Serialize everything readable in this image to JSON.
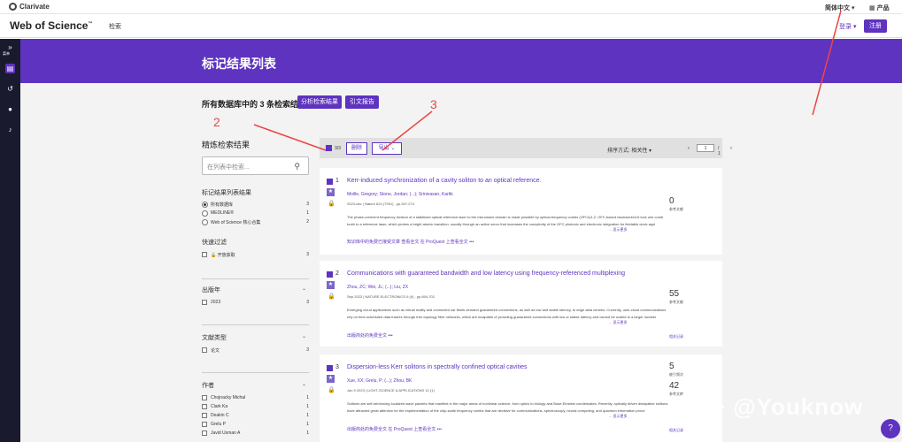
{
  "topbar": {
    "brand": "Clarivate",
    "language": "简体中文",
    "products": "产品"
  },
  "header": {
    "logo": "Web of Science",
    "logo_mark": "™",
    "nav_search": "检索",
    "login": "登录",
    "register": "注册"
  },
  "sidebar": {
    "label": "菜单"
  },
  "banner": {
    "title": "标记结果列表"
  },
  "summary": {
    "text": "所有数据库中的 3 条检索结果",
    "analyze_button": "分析检索结果",
    "citation_button": "引文报告"
  },
  "refine": {
    "title": "精炼检索结果",
    "search_placeholder": "在列表中检索...",
    "marked_lists": {
      "heading": "标记结果列表结果",
      "items": [
        {
          "label": "所有数据库",
          "count": "3"
        },
        {
          "label": "MEDLINE®",
          "count": "1"
        },
        {
          "label": "Web of Science 核心合集",
          "count": "2"
        }
      ]
    },
    "quick_filters": {
      "heading": "快速过滤",
      "items": [
        {
          "label": "开放获取",
          "count": "3"
        }
      ]
    },
    "pub_year": {
      "heading": "出版年",
      "items": [
        {
          "label": "2023",
          "count": "3"
        }
      ]
    },
    "doc_type": {
      "heading": "文献类型",
      "items": [
        {
          "label": "论文",
          "count": "3"
        }
      ]
    },
    "authors": {
      "heading": "作者",
      "items": [
        {
          "label": "Chojnacky Michal",
          "count": "1"
        },
        {
          "label": "Clark Ka",
          "count": "1"
        },
        {
          "label": "Deakin C",
          "count": "1"
        },
        {
          "label": "Grelu P",
          "count": "1"
        },
        {
          "label": "Javid Usman A",
          "count": "1"
        }
      ]
    }
  },
  "toolbar": {
    "selected": "3/3",
    "delete": "删除",
    "export": "导出",
    "sort": "排序方式: 相关性",
    "page_current": "1",
    "page_total": "/ 1"
  },
  "results": [
    {
      "num": "1",
      "title": "Kerr-induced synchronization of a cavity soliton to an optical reference.",
      "authors": "Moille, Gregory; Stone, Jordan; (...); Srinivasan, Kartik",
      "source": "2023-dec | Nature     624 (7991) , pp.267-274",
      "abstract": "The phase-coherent frequency division of a stabilized optical reference laser to the microwave domain is made possible by optical-frequency combs (OFCs)1,2. OFC-based clockworks3-6 lock one comb tooth to a reference laser, which probes a bright atomic transition, usually through an active servo that increases the complexity of the OFC photonic and electronic integration for fieldable clock appl",
      "more": "... 显示更多",
      "links": "知识库中的免费已接受文章    查看全文    在 ProQuest 上查看全文    •••",
      "metric_num": "0",
      "metric_label": "参考文献",
      "related": ""
    },
    {
      "num": "2",
      "title": "Communications with guaranteed bandwidth and low latency using frequency-referenced multiplexing",
      "authors": "Zhou, ZC; Wei, JL; (...); Liu, ZX",
      "source": "Sep 2023 | NATURE ELECTRONICS     6 (9) , pp.694-702",
      "abstract": "Emerging cloud applications such as virtual reality and connected car fleets demand guaranteed connections, as well as low and stable latency, to edge data centres. Currently, user-cloud communications rely on time-scheduled data frames through tree-topology fibre networks, which are incapable of providing guaranteed connections with low or stable latency and cannot be scaled to a larger number",
      "more": "... 显示更多",
      "links": "出版商处的免费全文    •••",
      "metric_num": "55",
      "metric_label": "参考文献",
      "related": "相关记录"
    },
    {
      "num": "3",
      "title": "Dispersion-less Kerr solitons in spectrally confined optical cavities",
      "authors": "Xue, XX; Grelu, P; (...); Zhou, BK",
      "source": "Jan 9 2023 | LIGHT-SCIENCE & APPLICATIONS     12 (1)",
      "abstract": "Solitons are self-reinforcing localized wave packets that manifest in the major areas of nonlinear science, from optics to biology and Bose-Einstein condensates. Recently, optically driven dissipative solitons have attracted great attention for the implementation of the chip-scale frequency combs that are decisive for communications, spectroscopy, neural computing, and quantum information proce",
      "more": "... 显示更多",
      "links": "出版商处的免费全文    在 ProQuest 上查看全文    •••",
      "metric_num": "5",
      "metric_label": "被引频次",
      "metric2_num": "42",
      "metric2_label": "参考文献",
      "related": "相关记录"
    }
  ],
  "annotations": [
    "2",
    "3"
  ],
  "help": "?",
  "watermark": "知乎 @Youknow",
  "colors": {
    "brand": "#5e33bf",
    "annotation": "#ee4444"
  }
}
